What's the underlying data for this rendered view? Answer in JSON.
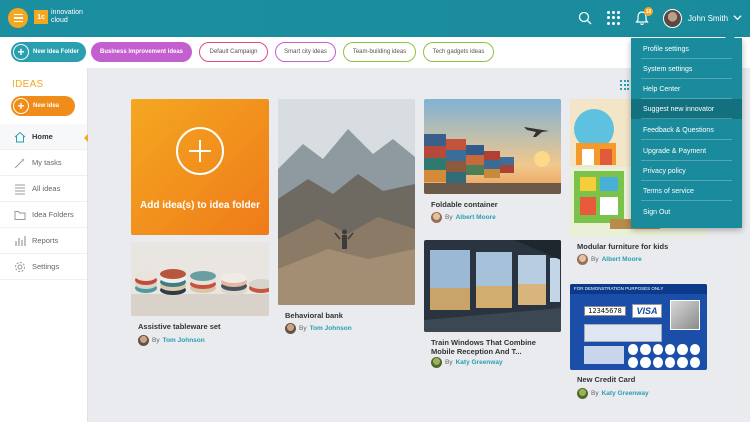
{
  "header": {
    "logo_mark": "1c",
    "logo_text_1": "innovation",
    "logo_text_2": "cloud",
    "notification_count": "18",
    "user_name": "John Smith"
  },
  "tags": {
    "new_folder": "New Idea Folder",
    "items": [
      "Business improvement ideas",
      "Default Campaign",
      "Smart city ideas",
      "Team-building ideas",
      "Tech gadgets ideas"
    ]
  },
  "sidebar": {
    "title": "IDEAS",
    "new_idea": "New idea",
    "items": [
      "Home",
      "My tasks",
      "All ideas",
      "Idea Folders",
      "Reports",
      "Settings"
    ]
  },
  "add_card": {
    "label": "Add idea(s) to idea folder"
  },
  "cards": [
    {
      "title": "Assistive tableware set",
      "by": "By",
      "author": "Tom Johnson"
    },
    {
      "title": "Behavioral bank",
      "by": "By",
      "author": "Tom Johnson"
    },
    {
      "title": "Foldable container",
      "by": "By",
      "author": "Albert Moore"
    },
    {
      "title": "Train Windows That Combine Mobile Reception And T...",
      "by": "By",
      "author": "Katy Greenway"
    },
    {
      "title": "Modular furniture for kids",
      "by": "By",
      "author": "Albert Moore"
    },
    {
      "title": "New Credit Card",
      "by": "By",
      "author": "Katy Greenway"
    }
  ],
  "credit_card": {
    "banner": "FOR DEMONSTRATION PURPOSES ONLY",
    "number": "12345678",
    "brand": "VISA"
  },
  "dropdown": {
    "items": [
      "Profile settings",
      "System settings",
      "Help Center",
      "Suggest new innovator",
      "Feedback & Questions",
      "Upgrade & Payment",
      "Privacy policy",
      "Terms of service",
      "Sign Out"
    ]
  },
  "colors": {
    "header": "#1a8b9c",
    "accent_orange": "#f4a720",
    "accent_teal": "#2a9fb0",
    "purple": "#c45fd0"
  }
}
